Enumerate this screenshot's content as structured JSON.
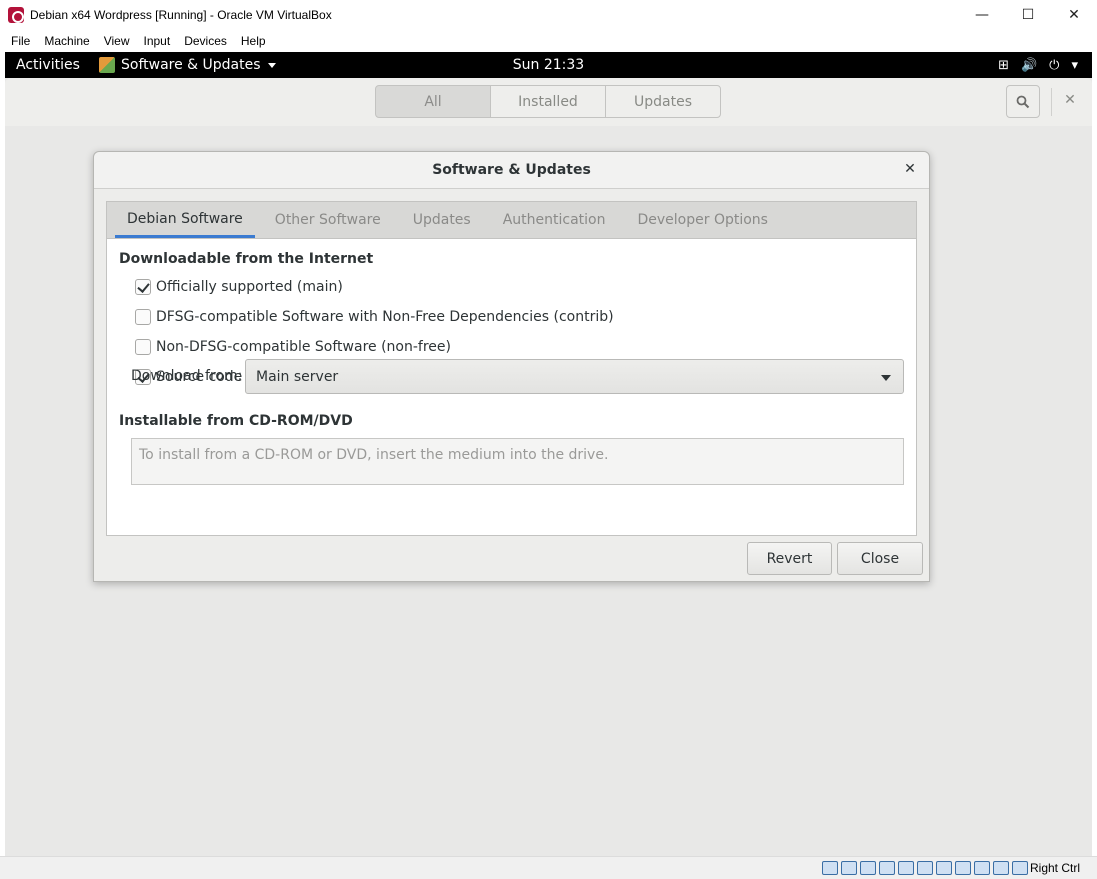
{
  "host": {
    "title": "Debian x64 Wordpress [Running] - Oracle VM VirtualBox",
    "controls": {
      "minimize": "—",
      "maximize": "☐",
      "close": "✕"
    },
    "menu": [
      "File",
      "Machine",
      "View",
      "Input",
      "Devices",
      "Help"
    ],
    "statusbar_host_key": "Right Ctrl"
  },
  "topbar": {
    "activities": "Activities",
    "app_menu": "Software & Updates",
    "clock": "Sun 21:33",
    "tray": {
      "network": "⊞",
      "volume": "🔊",
      "power": "⏻",
      "menu_caret": "▾"
    }
  },
  "gs_header": {
    "tabs": [
      "All",
      "Installed",
      "Updates"
    ],
    "close": "✕"
  },
  "dialog": {
    "title": "Software & Updates",
    "close": "✕",
    "tabs": [
      "Debian Software",
      "Other Software",
      "Updates",
      "Authentication",
      "Developer Options"
    ],
    "active_tab": "Debian Software",
    "internet_section": "Downloadable from the Internet",
    "options": [
      {
        "label": "Officially supported (main)",
        "checked": true
      },
      {
        "label": "DFSG-compatible Software with Non-Free Dependencies (contrib)",
        "checked": false
      },
      {
        "label": "Non-DFSG-compatible Software (non-free)",
        "checked": false
      },
      {
        "label": "Source code",
        "checked": true
      }
    ],
    "download_from_label": "Download from:",
    "download_from_value": "Main server",
    "cdrom_section": "Installable from CD-ROM/DVD",
    "cdrom_hint": "To install from a CD-ROM or DVD, insert the medium into the drive.",
    "revert": "Revert",
    "close_button": "Close"
  },
  "colors": {
    "accent": "#3b7bd1",
    "topbar": "#000000",
    "guest_bg": "#e8e8e7"
  }
}
